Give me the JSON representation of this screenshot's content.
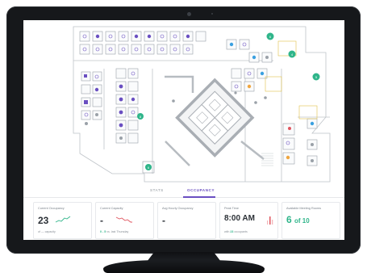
{
  "tabs": [
    {
      "label": "STATS",
      "active": false
    },
    {
      "label": "OCCUPANCY",
      "active": true
    }
  ],
  "cards": [
    {
      "label": "Current Occupancy",
      "value": "23",
      "sub": "of — capacity",
      "trend": "up"
    },
    {
      "label": "Current Capacity",
      "value": "-",
      "sub_highlight": "0 - 5",
      "sub": "vs. last Thursday",
      "trend": "down"
    },
    {
      "label": "Avg Hourly Occupancy",
      "value": "-"
    },
    {
      "label": "Peak Time",
      "value": "8:00 AM",
      "sub_prefix": "with",
      "sub_highlight": "23",
      "sub": "occupants"
    },
    {
      "label": "Available Meeting Rooms",
      "value_num": "6",
      "value_rest": "of 10"
    }
  ],
  "colors": {
    "accent_purple": "#6a4fc1",
    "teal": "#2fb58a",
    "red": "#e0555f",
    "blue_dot": "#3aa0e0",
    "orange_dot": "#f0a640"
  }
}
